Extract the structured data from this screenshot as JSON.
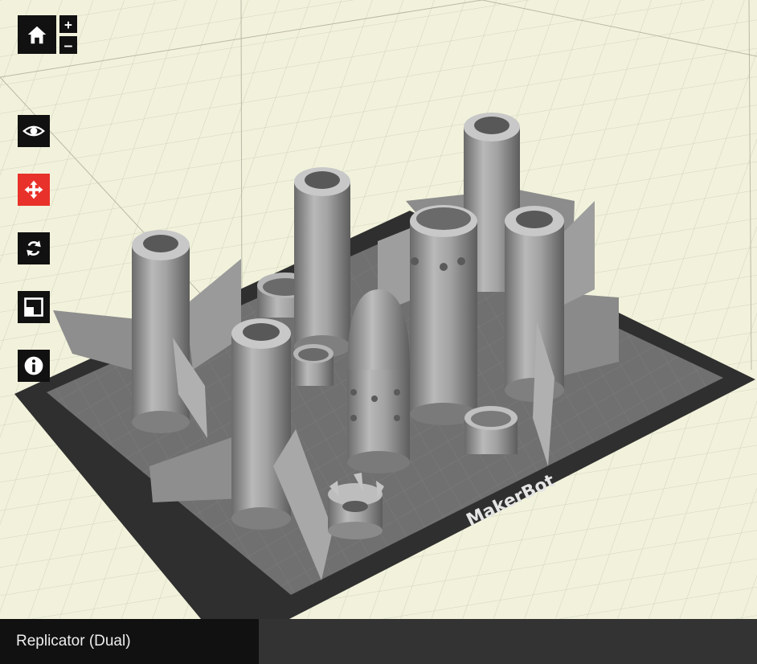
{
  "app": {
    "printer_name": "Replicator (Dual)",
    "bed_logo_text": "MakerBot"
  },
  "toolbar": {
    "home": {
      "icon": "home-icon"
    },
    "zoom_in_label": "+",
    "zoom_out_label": "–",
    "tools": [
      {
        "name": "view",
        "icon": "eye-icon",
        "active": false
      },
      {
        "name": "move",
        "icon": "move-arrows-icon",
        "active": true
      },
      {
        "name": "rotate",
        "icon": "rotate-icon",
        "active": false
      },
      {
        "name": "scale",
        "icon": "scale-icon",
        "active": false
      },
      {
        "name": "object-info",
        "icon": "info-icon",
        "active": false
      }
    ]
  },
  "colors": {
    "background": "#f2f2dc",
    "grid_line": "#c9cbb4",
    "build_plate": "#6e6e6e",
    "plate_border": "#2f2f2f",
    "part": "#9a9a9a",
    "active_tool": "#e8312a",
    "toolbar": "#111111",
    "status_bar": "#333333"
  }
}
